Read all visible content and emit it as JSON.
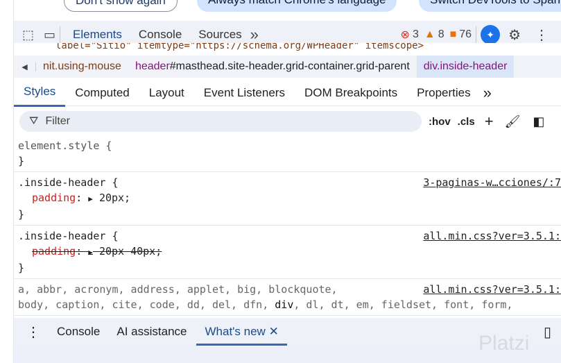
{
  "banner": {
    "buttons": [
      "Don't show again",
      "Always match Chrome's language",
      "Switch DevTools to Spanish"
    ]
  },
  "toolbar": {
    "tabs": [
      "Elements",
      "Console",
      "Sources"
    ],
    "more": "»",
    "errors": "3",
    "warnings": "8",
    "issues": "76"
  },
  "cut_line": "label=\"Sitio\" itemtype=\"https://schema.org/WPHeader\" itemscope>",
  "breadcrumb": {
    "items": [
      {
        "tag": "",
        "rest": "nit.using-mouse"
      },
      {
        "tag": "header",
        "rest": "#masthead.site-header.grid-container.grid-parent"
      },
      {
        "tag": "div",
        "rest": ".inside-header"
      }
    ]
  },
  "subtabs": [
    "Styles",
    "Computed",
    "Layout",
    "Event Listeners",
    "DOM Breakpoints",
    "Properties"
  ],
  "filter": {
    "placeholder": "Filter",
    "hov": ":hov",
    "cls": ".cls"
  },
  "rules": [
    {
      "selector": "element.style {",
      "close": "}"
    },
    {
      "selector": ".inside-header {",
      "source": "3-paginas-w…cciones/:7",
      "prop": "padding",
      "value": "20px;",
      "close": "}"
    },
    {
      "selector": ".inside-header {",
      "source": "all.min.css?ver=3.5.1:",
      "prop": "padding",
      "value": "20px 40px;",
      "close": "}"
    },
    {
      "selector1": "a, abbr, acronym, address, applet, big, blockquote,",
      "selector2a": "body, caption, cite, code, dd, del, dfn, ",
      "selector2b": "div",
      "selector2c": ", dl, dt, em, fieldset, font, form,",
      "source": "all.min.css?ver=3.5.1:"
    }
  ],
  "drawer": {
    "tabs": [
      "Console",
      "AI assistance",
      "What's new"
    ]
  },
  "watermark": "Platzi"
}
